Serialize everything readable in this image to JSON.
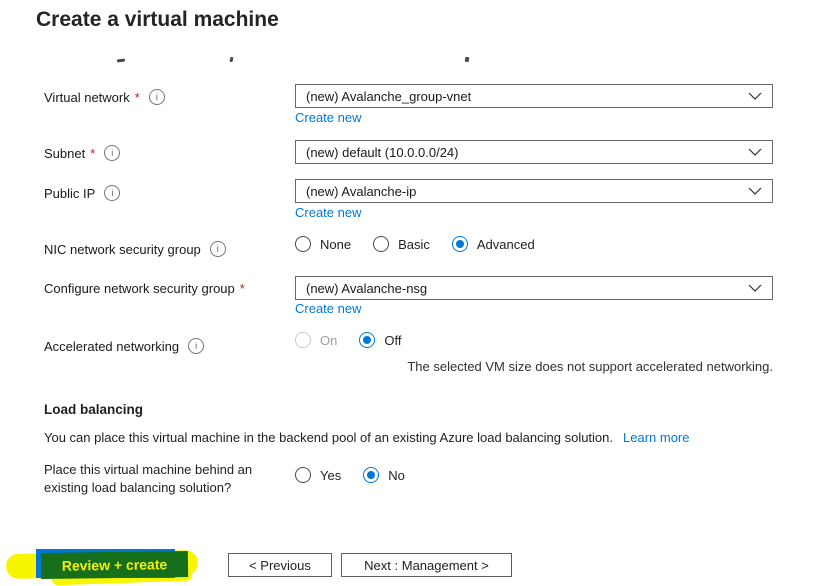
{
  "page": {
    "title": "Create a virtual machine"
  },
  "fields": {
    "virtual_network": {
      "label": "Virtual network",
      "required": "*",
      "value": "(new) Avalanche_group-vnet",
      "create_new": "Create new"
    },
    "subnet": {
      "label": "Subnet",
      "required": "*",
      "value": "(new) default (10.0.0.0/24)"
    },
    "public_ip": {
      "label": "Public IP",
      "value": "(new) Avalanche-ip",
      "create_new": "Create new"
    },
    "nic_nsg": {
      "label": "NIC network security group",
      "options": [
        {
          "label": "None"
        },
        {
          "label": "Basic"
        },
        {
          "label": "Advanced"
        }
      ],
      "selected": "Advanced"
    },
    "configure_nsg": {
      "label": "Configure network security group",
      "required": "*",
      "value": "(new) Avalanche-nsg",
      "create_new": "Create new"
    },
    "accelerated_networking": {
      "label": "Accelerated networking",
      "options": [
        {
          "label": "On",
          "disabled": true
        },
        {
          "label": "Off"
        }
      ],
      "selected": "Off",
      "note": "The selected VM size does not support accelerated networking."
    }
  },
  "load_balancing": {
    "heading": "Load balancing",
    "description": "You can place this virtual machine in the backend pool of an existing Azure load balancing solution.",
    "learn_more": "Learn more",
    "question_line1": "Place this virtual machine behind an",
    "question_line2": "existing load balancing solution?",
    "options": [
      {
        "label": "Yes"
      },
      {
        "label": "No"
      }
    ],
    "selected": "No"
  },
  "footer": {
    "review_create": "Review + create",
    "previous": "< Previous",
    "next": "Next : Management >"
  },
  "colors": {
    "accent": "#0078d4",
    "required_red": "#a4262c",
    "highlight_yellow": "#f8f500",
    "review_button_green": "#166f1b",
    "review_button_underlay_blue": "#0078d4"
  }
}
